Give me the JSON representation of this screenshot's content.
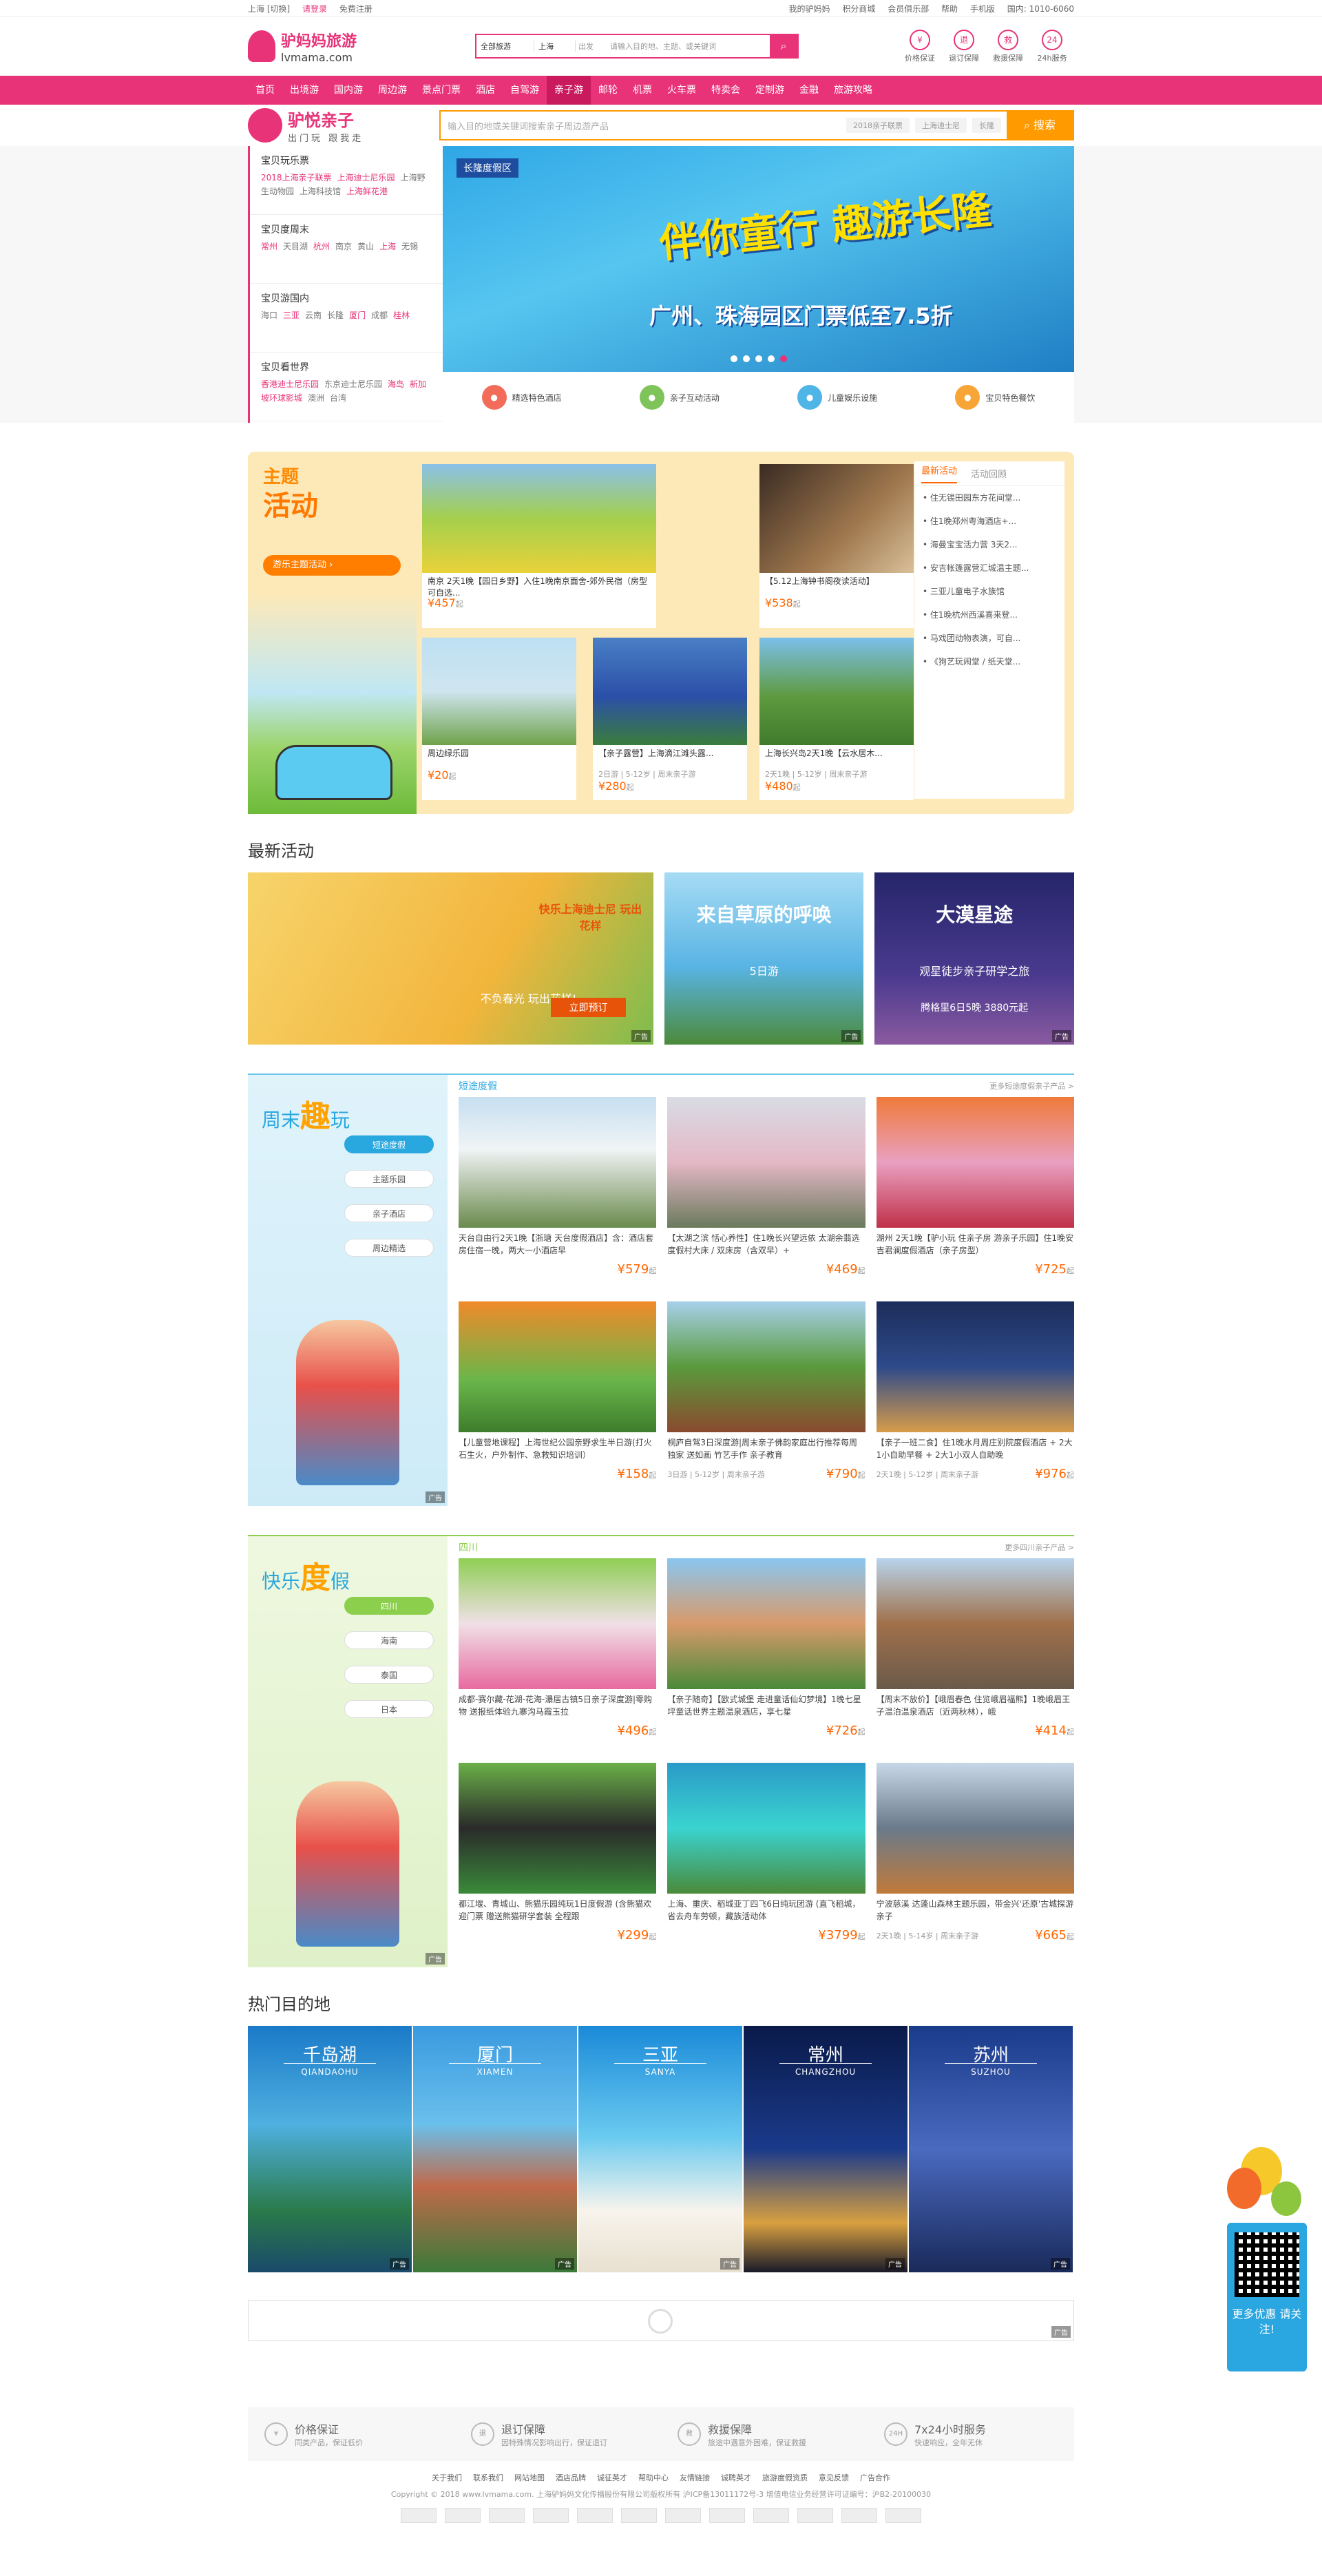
{
  "topbar": {
    "city": "上海 [切换]",
    "login": "请登录",
    "register": "免费注册",
    "links": [
      "我的驴妈妈",
      "积分商城",
      "会员俱乐部",
      "帮助"
    ],
    "mobile": "手机版",
    "hotline": "国内: 1010-6060"
  },
  "header": {
    "brand_cn": "驴妈妈旅游",
    "brand_en": "lvmama.com",
    "search_scope": "全部旅游",
    "search_city": "上海",
    "search_dep": "出发",
    "search_placeholder": "请输入目的地、主题、或关键词",
    "icons": [
      {
        "name": "price-guarantee-icon",
        "glyph": "¥",
        "label": "价格保证"
      },
      {
        "name": "refund-icon",
        "glyph": "退",
        "label": "退订保障"
      },
      {
        "name": "rescue-icon",
        "glyph": "救",
        "label": "救援保障"
      },
      {
        "name": "service-24h-icon",
        "glyph": "24",
        "label": "24h服务"
      }
    ]
  },
  "nav": {
    "items": [
      "首页",
      "出境游",
      "国内游",
      "周边游",
      "景点门票",
      "酒店",
      "自驾游",
      "亲子游",
      "邮轮",
      "机票",
      "火车票",
      "特卖会",
      "定制游",
      "金融",
      "旅游攻略"
    ],
    "active": "亲子游"
  },
  "parent": {
    "title": "驴悦亲子",
    "subtitle": "出门玩 跟我走",
    "search_placeholder": "输入目的地或关键词搜索亲子周边游产品",
    "tags": [
      "2018亲子联票",
      "上海迪士尼",
      "长隆"
    ],
    "search_button": "搜索"
  },
  "categories": [
    {
      "title": "宝贝玩乐票",
      "items": [
        {
          "t": "2018上海亲子联票",
          "r": true
        },
        {
          "t": "上海迪士尼乐园",
          "r": true
        },
        {
          "t": "上海野生动物园",
          "r": false
        },
        {
          "t": "上海科技馆",
          "r": false
        },
        {
          "t": "上海鲜花港",
          "r": true
        }
      ]
    },
    {
      "title": "宝贝度周末",
      "items": [
        {
          "t": "常州",
          "r": true
        },
        {
          "t": "天目湖",
          "r": false
        },
        {
          "t": "杭州",
          "r": true
        },
        {
          "t": "南京",
          "r": false
        },
        {
          "t": "黄山",
          "r": false
        },
        {
          "t": "上海",
          "r": true
        },
        {
          "t": "无锡",
          "r": false
        }
      ]
    },
    {
      "title": "宝贝游国内",
      "items": [
        {
          "t": "海口",
          "r": false
        },
        {
          "t": "三亚",
          "r": true
        },
        {
          "t": "云南",
          "r": false
        },
        {
          "t": "长隆",
          "r": false
        },
        {
          "t": "厦门",
          "r": true
        },
        {
          "t": "成都",
          "r": false
        },
        {
          "t": "桂林",
          "r": true
        }
      ]
    },
    {
      "title": "宝贝看世界",
      "items": [
        {
          "t": "香港迪士尼乐园",
          "r": true
        },
        {
          "t": "东京迪士尼乐园",
          "r": false
        },
        {
          "t": "海岛",
          "r": true
        },
        {
          "t": "新加坡环球影城",
          "r": true
        },
        {
          "t": "澳洲",
          "r": false
        },
        {
          "t": "台湾",
          "r": false
        }
      ]
    }
  ],
  "banner": {
    "badge": "长隆度假区",
    "headline": "伴你童行 趣游长隆",
    "sub": "广州、珠海园区门票低至7.5折",
    "slides": 5,
    "active_slide": 5
  },
  "features": [
    {
      "label": "精选特色酒店",
      "icon": "hotel-icon",
      "color": "#f36c5a"
    },
    {
      "label": "亲子互动活动",
      "icon": "activity-icon",
      "color": "#7ec45a"
    },
    {
      "label": "儿童娱乐设施",
      "icon": "playground-icon",
      "color": "#4fb4e6"
    },
    {
      "label": "宝贝特色餐饮",
      "icon": "food-icon",
      "color": "#f7a536"
    }
  ],
  "theme": {
    "title_a": "主题",
    "title_b": "活动",
    "pill": "游乐主题活动",
    "cards": [
      {
        "title": "南京 2天1晚【园日乡野】入住1晚南京面舍-郊外民宿（房型可自选...",
        "price": "¥457",
        "unit": "起",
        "meta": "",
        "img": "linear-gradient(#8ac0e8,#a4cf4c 50%,#e9d23a)"
      },
      {
        "title": "【5.12上海钟书阁夜读活动】",
        "price": "¥538",
        "unit": "起",
        "meta": "",
        "img": "linear-gradient(135deg,#3a2b22,#a0784e 60%,#d9c099)"
      },
      {
        "title": "周边绿乐园",
        "price": "¥20",
        "unit": "起",
        "meta": "",
        "img": "linear-gradient(#bde0f2,#cfe5f0 50%,#6ea24a)"
      },
      {
        "title": "【亲子露营】上海滴江滩头露...",
        "price": "¥280",
        "unit": "起",
        "meta": "2日游 | 5-12岁 | 周末亲子游",
        "img": "linear-gradient(#4a7fc6,#2b4fa8 55%,#3a7d3c)"
      },
      {
        "title": "上海长兴岛2天1晚【云水居木...",
        "price": "¥480",
        "unit": "起",
        "meta": "2天1晚 | 5-12岁 | 周末亲子游",
        "img": "linear-gradient(#7cc0ec,#5e9a3e 55%,#3f7b2c)"
      }
    ],
    "side_tabs": [
      "最新活动",
      "活动回顾"
    ],
    "side_items": [
      "住无锡田园东方花间堂...",
      "住1晚郑州粤海酒店+...",
      "海曼宝宝活力营 3天2...",
      "安吉帐篷露营汇城温主题...",
      "三亚儿童电子水族馆",
      "住1晚杭州西溪喜来登...",
      "马戏团动物表演，可自...",
      "《狗艺玩闹堂 / 纸天堂..."
    ]
  },
  "newact": {
    "title": "最新活动",
    "banners": [
      {
        "text": "快乐上海迪士尼 玩出花样",
        "sub": "不负春光 玩出花样!",
        "btn": "立即预订",
        "bg": "linear-gradient(120deg,#f7d46b,#f2b53c 60%,#7dbd4e)"
      },
      {
        "text": "来自草原的呼唤",
        "sub": "5日游",
        "btn": "",
        "bg": "linear-gradient(#a6dbf5,#58b4e3 55%,#4c8a3a)"
      },
      {
        "text": "大漠星途",
        "sub": "观星徒步亲子研学之旅",
        "btn": "腾格里6日5晚 3880元起",
        "bg": "linear-gradient(#25256a,#4a3a8e 60%,#8a5aa0)"
      }
    ]
  },
  "weekend": {
    "title_a": "周末",
    "title_b": "趣",
    "title_c": "玩",
    "tabs": [
      "短途度假",
      "主题乐园",
      "亲子酒店",
      "周边精选"
    ],
    "active": "短途度假",
    "head": "短途度假",
    "more": "更多短途度假亲子产品 >",
    "products": [
      {
        "title": "天台自由行2天1晚【浙瑭 天台度假酒店】含：酒店套房住宿一晚，两大一小酒店早",
        "meta": "",
        "price": "¥579",
        "unit": "起",
        "bg": "linear-gradient(#c6dff0,#f0f4f6 40%,#6a8a4c)"
      },
      {
        "title": "【太湖之滨 恬心养性】住1晚长兴望远依 太湖余翡选度假村大床 / 双床房（含双早）+",
        "meta": "",
        "price": "¥469",
        "unit": "起",
        "bg": "linear-gradient(#d8dce4,#e4b8c6 50%,#6a7a5c)"
      },
      {
        "title": "湖州 2天1晚【驴小玩 住亲子房 游亲子乐园】住1晚安吉君澜度假酒店（亲子房型）",
        "meta": "",
        "price": "¥725",
        "unit": "起",
        "bg": "linear-gradient(#f07a3a,#e9a0c0 50%,#c0304a)"
      },
      {
        "title": "【儿童营地课程】上海世纪公园亲野求生半日游(打火石生火，户外制作、急救知识培训）",
        "meta": "",
        "price": "¥158",
        "unit": "起",
        "bg": "linear-gradient(#f08a2a,#6ab64a 60%,#3d7d2c)"
      },
      {
        "title": "桐庐自驾3日深度游|周末亲子佛韵家庭出行推荐每周独家 送如画 竹艺手作 亲子教育",
        "meta": "3日游 | 5-12岁 | 周末亲子游",
        "price": "¥790",
        "unit": "起",
        "bg": "linear-gradient(#a8d0ec,#5a9a3c 50%,#8a4a2e)"
      },
      {
        "title": "【亲子一班二食】住1晚水月周庄别院度假酒店 + 2大1小自助早餐 + 2大1小双人自助晚",
        "meta": "2天1晚 | 5-12岁 | 周末亲子游",
        "price": "¥976",
        "unit": "起",
        "bg": "linear-gradient(#1c2d5a,#2e4a8a 50%,#d79c4a)"
      }
    ]
  },
  "holiday": {
    "title_a": "快乐",
    "title_b": "度",
    "title_c": "假",
    "tabs": [
      "四川",
      "海南",
      "泰国",
      "日本"
    ],
    "active": "四川",
    "head": "四川",
    "more": "更多四川亲子产品 >",
    "products": [
      {
        "title": "成都-赛尔藏-花湖-花海-瀑居古镇5日亲子深度游|零购物 送报纸体验九寨沟马霞玉拉",
        "meta": "",
        "price": "¥496",
        "unit": "起",
        "bg": "linear-gradient(#8fce54,#f0e0e6 50%,#e86aa0)"
      },
      {
        "title": "【亲子随奇】【欧式城堡 走进童话仙幻梦境】1晚七星坪童话世界主题温泉酒店，享七星",
        "meta": "",
        "price": "¥726",
        "unit": "起",
        "bg": "linear-gradient(#8ac6f0,#d89a6a 50%,#4a8a3a)"
      },
      {
        "title": "【周末不放价】【峨眉春色 住览峨眉福熊】1晚峨眉王子温泊温泉酒店（近两秋林），峨",
        "meta": "",
        "price": "¥414",
        "unit": "起",
        "bg": "linear-gradient(#b8d4ec,#a0704a 50%,#6a5a4a)"
      },
      {
        "title": "都江堰、青城山、熊猫乐园纯玩1日度假游 (含熊猫欢迎门票 赠送熊猫研学套装 全程跟",
        "meta": "",
        "price": "¥299",
        "unit": "起",
        "bg": "linear-gradient(#6ab048,#2a2a2a 50%,#3a8a3a)"
      },
      {
        "title": "上海、重庆、稻城亚丁四飞6日纯玩团游 (直飞稻城，省去舟车劳顿，藏族活动体",
        "meta": "",
        "price": "¥3799",
        "unit": "起",
        "bg": "linear-gradient(#2a9ac8,#3ad4d0 50%,#4a8a3a)"
      },
      {
        "title": "宁波慈溪 达蓬山森林主题乐园，带金兴'还原'古城探游亲子",
        "meta": "2天1晚 | 5-14岁 | 周末亲子游",
        "price": "¥665",
        "unit": "起",
        "bg": "linear-gradient(#c8d8e8,#6a7a8a 50%,#c07a3a)"
      }
    ]
  },
  "destinations": {
    "title": "热门目的地",
    "items": [
      {
        "cn": "千岛湖",
        "en": "QIANDAOHU",
        "bg": "linear-gradient(#1a7ac8,#4fb0e0 40%,#2a7a4a 75%,#1a4a6a)"
      },
      {
        "cn": "厦门",
        "en": "XIAMEN",
        "bg": "linear-gradient(#3a9ae0,#6ac0ec 40%,#c06a4a 65%,#3a7a3a)"
      },
      {
        "cn": "三亚",
        "en": "SANYA",
        "bg": "linear-gradient(#1a8ad8,#6acaf0 45%,#f8f4ec 75%,#e8e0d0)"
      },
      {
        "cn": "常州",
        "en": "CHANGZHOU",
        "bg": "linear-gradient(#0a1a4a,#1a3a8a 50%,#d8a040 80%,#1a1a2a)"
      },
      {
        "cn": "苏州",
        "en": "SUZHOU",
        "bg": "linear-gradient(#1a3a8a,#4a6ac0 50%,#1a2a5a)"
      }
    ]
  },
  "ad_label": "广告",
  "guarantees": [
    {
      "icon": "¥",
      "t": "价格保证",
      "s": "同类产品，保证低价"
    },
    {
      "icon": "退",
      "t": "退订保障",
      "s": "因特殊情况影响出行，保证退订"
    },
    {
      "icon": "救",
      "t": "救援保障",
      "s": "旅途中遇意外困难，保证救援"
    },
    {
      "icon": "24H",
      "t": "7x24小时服务",
      "s": "快速响应，全年无休"
    }
  ],
  "footer": {
    "links": [
      "关于我们",
      "联系我们",
      "网站地图",
      "酒店品牌",
      "诚征英才",
      "帮助中心",
      "友情链接",
      "诚聘英才",
      "旅游度假资质",
      "意见反馈",
      "广告合作"
    ],
    "copyright": "Copyright © 2018 www.lvmama.com. 上海驴妈妈文化传播股份有限公司版权所有  沪ICP备13011172号-3  增值电信业务经营许可证编号：沪B2-20100030",
    "badges": 12
  },
  "float": {
    "qr_text": "更多优惠 请关注!"
  }
}
